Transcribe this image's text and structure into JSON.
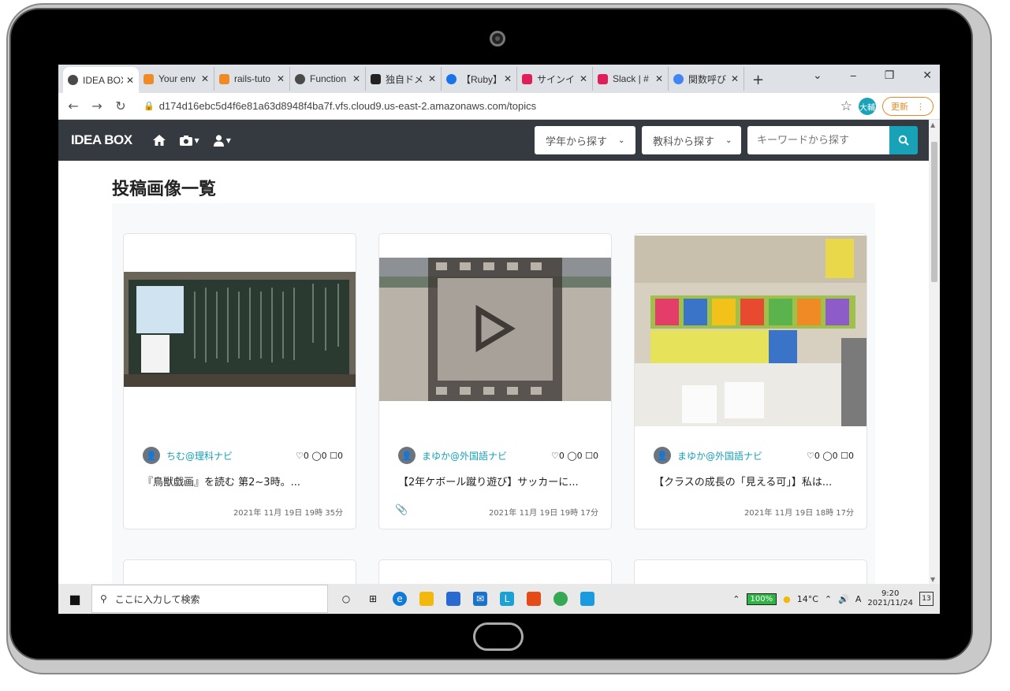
{
  "browser": {
    "tabs": [
      {
        "label": "IDEA BOX",
        "color": "#4a4a4a",
        "active": true
      },
      {
        "label": "Your env",
        "color": "#f08a24"
      },
      {
        "label": "rails-tuto",
        "color": "#f08a24"
      },
      {
        "label": "Function",
        "color": "#4a4a4a"
      },
      {
        "label": "独自ドメ",
        "color": "#222222"
      },
      {
        "label": "【Ruby】|",
        "color": "#1a73e8"
      },
      {
        "label": "サインイン",
        "color": "#e01e5a"
      },
      {
        "label": "Slack | #",
        "color": "#e01e5a"
      },
      {
        "label": "関数呼び",
        "color": "#4285f4"
      }
    ],
    "url": "d174d16ebc5d4f6e81a63d8948f4ba7f.vfs.cloud9.us-east-2.amazonaws.com/topics",
    "profile_initial": "大輔",
    "update_label": "更新"
  },
  "navbar": {
    "brand": "IDEA BOX",
    "grade_select": "学年から探す",
    "subject_select": "教科から探す",
    "search_placeholder": "キーワードから探す"
  },
  "page_title": "投稿画像一覧",
  "cards": [
    {
      "author": "ちむ@理科ナビ",
      "likes": "0",
      "comments": "0",
      "bookmarks": "0",
      "title": "『鳥獣戯画』を読む 第2~3時。...",
      "date": "2021年 11月 19日 19時 35分",
      "attachment": false
    },
    {
      "author": "まゆか@外国語ナビ",
      "likes": "0",
      "comments": "0",
      "bookmarks": "0",
      "title": "【2年ケボール蹴り遊び】サッカーに...",
      "date": "2021年 11月 19日 19時 17分",
      "attachment": true
    },
    {
      "author": "まゆか@外国語ナビ",
      "likes": "0",
      "comments": "0",
      "bookmarks": "0",
      "title": "【クラスの成長の「見える可」】私は...",
      "date": "2021年 11月 19日 18時 17分",
      "attachment": false
    }
  ],
  "taskbar": {
    "search_placeholder": "ここに入力して検索",
    "battery": "100%",
    "temperature": "14°C",
    "ime": "A",
    "time": "9:20",
    "date": "2021/11/24",
    "notifications": "13"
  }
}
